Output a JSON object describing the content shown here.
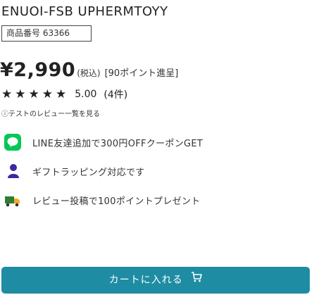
{
  "product": {
    "title": "ENUOI-FSB UPHERMTOYY",
    "code": "商品番号 63366"
  },
  "price": {
    "amount": "¥2,990",
    "tax_label": "(税込)",
    "points": "[90ポイント進呈]"
  },
  "rating": {
    "stars": 4.5,
    "value": "5.00",
    "review_count": "(4件)"
  },
  "notice": "ⓘテストのレビュー一覧を見る",
  "benefits": [
    {
      "icon": "line-icon",
      "text": "LINE友達追加で300円OFFクーポンGET"
    },
    {
      "icon": "baby-icon",
      "text": "ギフトラッピング対応です"
    },
    {
      "icon": "truck-icon",
      "text": "レビュー投稿で100ポイントプレゼント"
    }
  ],
  "cart_button": {
    "label": "カートに入れる"
  },
  "colors": {
    "accent": "#1e8ca3",
    "line_green": "#06c755",
    "text": "#222222"
  }
}
